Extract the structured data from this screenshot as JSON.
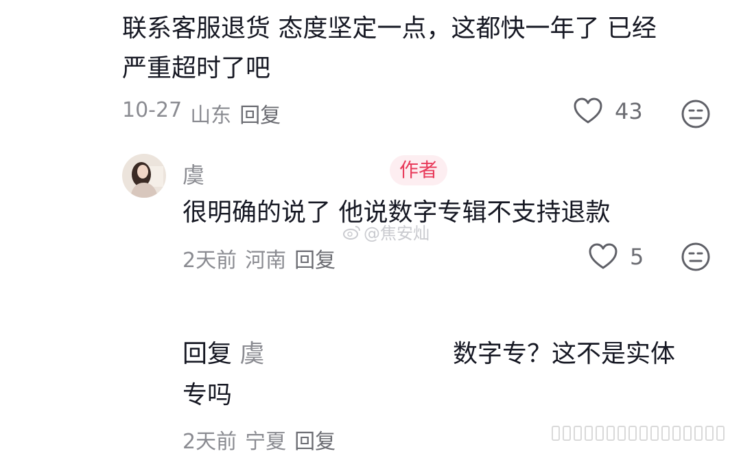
{
  "comment1": {
    "line1": "联系客服退货 态度坚定一点，这都快一年了 已经",
    "line2": "严重超时了吧",
    "date": "10-27",
    "location": "山东",
    "reply_label": "回复",
    "likes": "43"
  },
  "comment2": {
    "username": "虞",
    "badge": "作者",
    "text": "很明确的说了 他说数字专辑不支持退款",
    "date": "2天前",
    "location": "河南",
    "reply_label": "回复",
    "likes": "5"
  },
  "watermark": {
    "text": "@焦安灿"
  },
  "comment3": {
    "reply_prefix": "回复",
    "reply_target": "虞",
    "line1_tail": "数字专？这不是实体",
    "line2": "专吗",
    "date": "2天前",
    "location": "宁夏",
    "reply_label": "回复"
  },
  "icons": {
    "like": "heart-outline-icon",
    "reaction": "neutral-face-icon"
  },
  "colors": {
    "author_badge_bg": "#fdeef1",
    "author_badge_text": "#e83a5a",
    "meta_gray": "#8a8b91"
  }
}
